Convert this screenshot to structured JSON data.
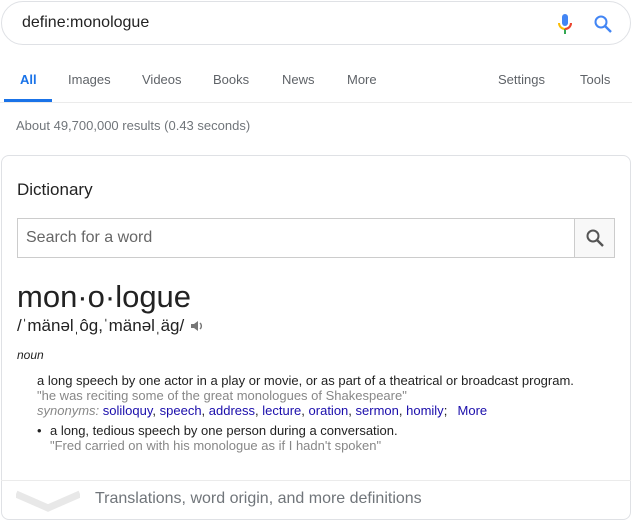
{
  "search": {
    "query": "define:monologue",
    "mic_icon": "mic-icon",
    "search_icon": "search-icon"
  },
  "tabs": [
    {
      "label": "All",
      "active": true
    },
    {
      "label": "Images"
    },
    {
      "label": "Videos"
    },
    {
      "label": "Books"
    },
    {
      "label": "News"
    },
    {
      "label": "More"
    },
    {
      "label": "Settings"
    },
    {
      "label": "Tools"
    }
  ],
  "stats": "About 49,700,000 results (0.43 seconds)",
  "dictionary": {
    "title": "Dictionary",
    "search_placeholder": "Search for a word",
    "headword": "mon·o·logue",
    "pronunciation": "/ˈmänəlˌôɡ,ˈmänəlˌäɡ/",
    "pos": "noun",
    "definitions": [
      {
        "text": "a long speech by one actor in a play or movie, or as part of a theatrical or broadcast program.",
        "example": "\"he was reciting some of the great monologues of Shakespeare\"",
        "synonyms_label": "synonyms:",
        "synonyms": [
          "soliloquy",
          "speech",
          "address",
          "lecture",
          "oration",
          "sermon",
          "homily"
        ],
        "more": "More"
      },
      {
        "text": "a long, tedious speech by one person during a conversation.",
        "example": "\"Fred carried on with his monologue as if I hadn't spoken\""
      }
    ],
    "more_definitions": "Translations, word origin, and more definitions"
  },
  "colors": {
    "accent": "#1a73e8",
    "link": "#1a0dab",
    "muted": "#70757a"
  }
}
